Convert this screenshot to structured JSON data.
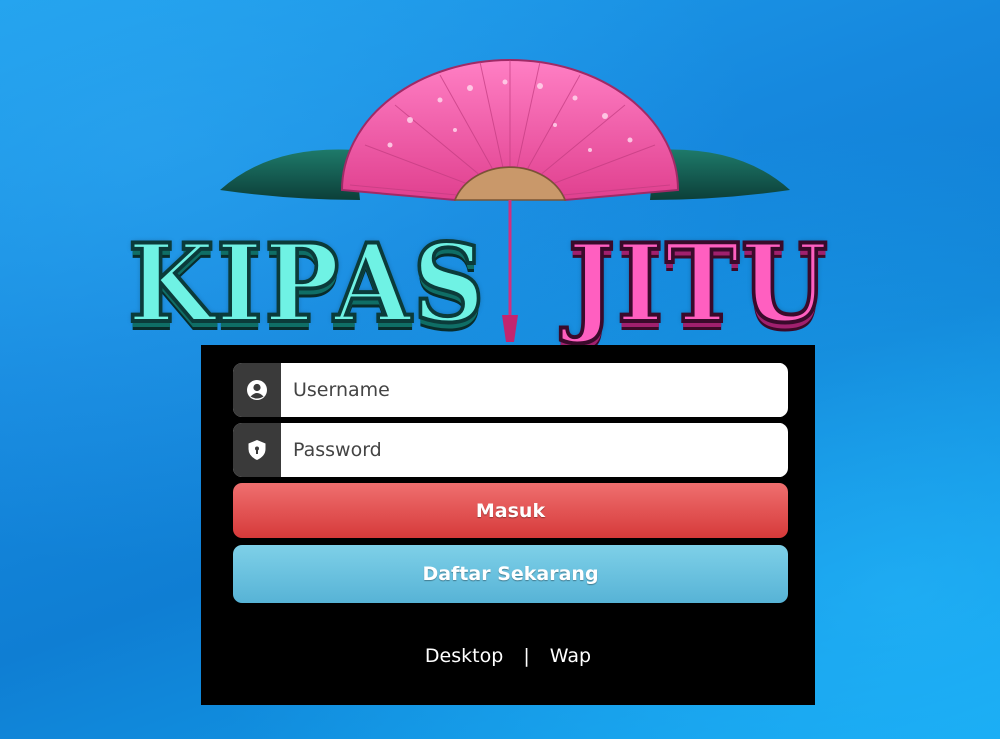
{
  "logo": {
    "word_1": "KIPAS",
    "word_2": "JITU",
    "word_1_color": "#6ff2e4",
    "word_2_color": "#ff5fc0"
  },
  "login_form": {
    "username_placeholder": "Username",
    "password_placeholder": "Password",
    "username_icon": "user-circle-icon",
    "password_icon": "shield-icon",
    "login_button": "Masuk",
    "register_button": "Daftar Sekarang",
    "login_color": "#e05050",
    "register_color": "#6ac2e0"
  },
  "footer": {
    "desktop_link": "Desktop",
    "separator": "|",
    "wap_link": "Wap"
  },
  "colors": {
    "background": "#1688de",
    "panel": "#000000"
  }
}
